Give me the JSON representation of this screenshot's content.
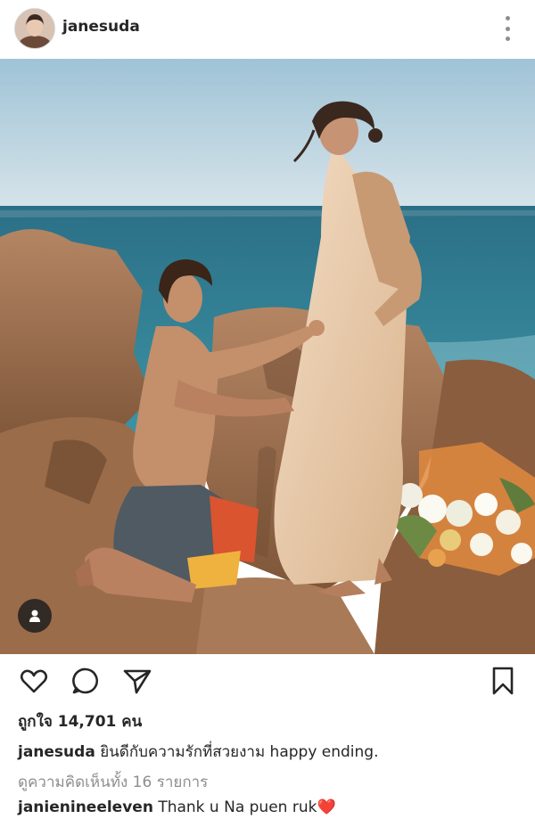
{
  "post": {
    "username": "janesuda",
    "likes_label": "ถูกใจ 14,701 คน",
    "caption_user": "janesuda",
    "caption_text": "ยินดีกับความรักที่สวยงาม happy ending.",
    "view_comments": "ดูความคิดเห็นทั้ง 16 รายการ",
    "comment_user": "janienineeleven",
    "comment_text": "Thank u Na puen ruk",
    "comment_emoji": "❤️"
  },
  "icons": {
    "more": "more-vertical-icon",
    "like": "heart-icon",
    "comment": "comment-bubble-icon",
    "share": "paper-plane-icon",
    "save": "bookmark-icon",
    "tag": "user-tag-icon"
  },
  "colors": {
    "text": "#262626",
    "secondary": "#8e8e8e",
    "heart": "#e0245e"
  }
}
